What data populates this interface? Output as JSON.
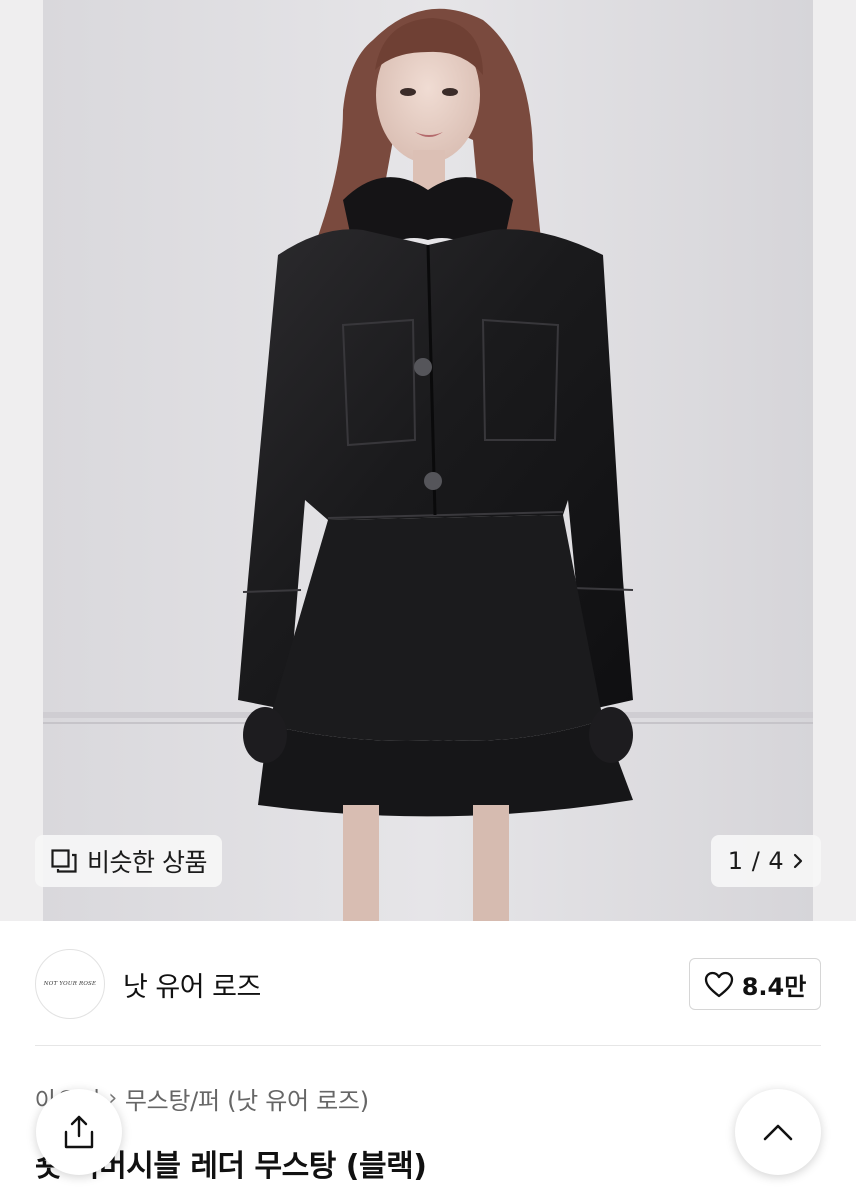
{
  "gallery": {
    "similar_label": "비슷한 상품",
    "page_indicator": "1 / 4",
    "current_page": 1,
    "total_pages": 4
  },
  "brand": {
    "logo_text": "NOT YOUR ROSE",
    "name": "낫 유어 로즈",
    "like_count": "8.4만"
  },
  "breadcrumb": {
    "items": [
      "아우터",
      "무스탕/퍼 (낫 유어 로즈)"
    ]
  },
  "product": {
    "title": "숏 리버시블 레더 무스탕 (블랙)"
  },
  "icons": {
    "similar": "stacked-squares-icon",
    "pager": "chevron-right-icon",
    "like": "heart-outline-icon",
    "share": "share-upload-icon",
    "top": "chevron-up-icon"
  }
}
